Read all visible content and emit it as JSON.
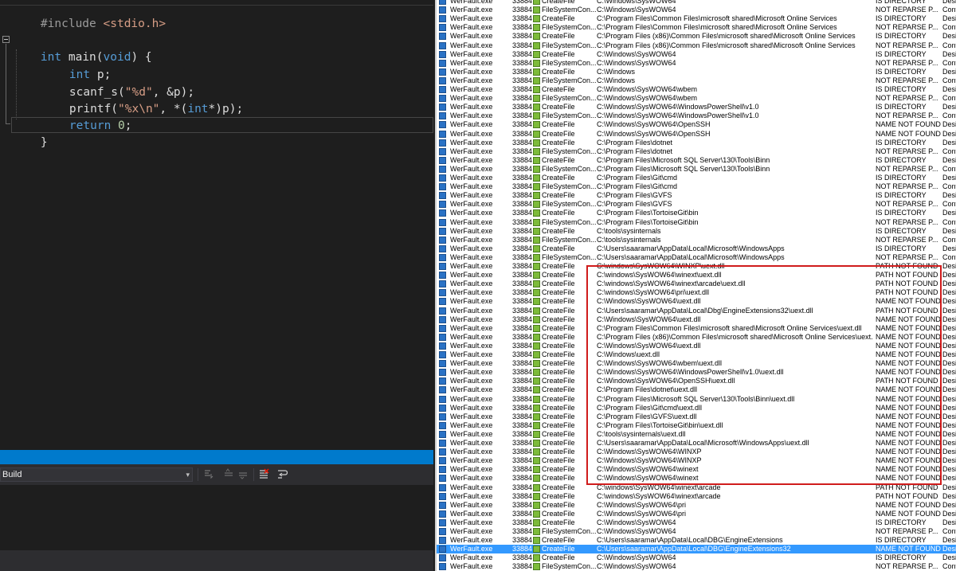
{
  "editor": {
    "include_directive": "#include",
    "include_file": "<stdio.h>",
    "line_main_type": "int",
    "line_main_name": " main(",
    "line_main_void": "void",
    "line_main_rest": ") {",
    "decl_type": "int",
    "decl_rest": " p;",
    "scanf_call": "scanf_s(",
    "scanf_fmt": "\"%d\"",
    "scanf_rest": ", &p);",
    "printf_call": "printf(",
    "printf_fmt": "\"%x\\n\"",
    "printf_mid": ", *(",
    "printf_cast": "int",
    "printf_rest": "*)p);",
    "return_kw": "return",
    "return_val": "0",
    "return_semicolon": ";",
    "close_brace": "}"
  },
  "output_pane": {
    "source_selected": "Build",
    "dropdown_chevron": "▾"
  },
  "procmon": {
    "process": "WerFault.exe",
    "pid": "33884",
    "rows": [
      {
        "op": "CreateFile",
        "path": "C:\\Windows\\SysWOW64",
        "result": "IS DIRECTORY",
        "detail": "Desi"
      },
      {
        "op": "FileSystemCon...",
        "path": "C:\\Windows\\SysWOW64",
        "result": "NOT REPARSE P...",
        "detail": "Cont"
      },
      {
        "op": "CreateFile",
        "path": "C:\\Program Files\\Common Files\\microsoft shared\\Microsoft Online Services",
        "result": "IS DIRECTORY",
        "detail": "Desi"
      },
      {
        "op": "FileSystemCon...",
        "path": "C:\\Program Files\\Common Files\\microsoft shared\\Microsoft Online Services",
        "result": "NOT REPARSE P...",
        "detail": "Cont"
      },
      {
        "op": "CreateFile",
        "path": "C:\\Program Files (x86)\\Common Files\\microsoft shared\\Microsoft Online Services",
        "result": "IS DIRECTORY",
        "detail": "Desi"
      },
      {
        "op": "FileSystemCon...",
        "path": "C:\\Program Files (x86)\\Common Files\\microsoft shared\\Microsoft Online Services",
        "result": "NOT REPARSE P...",
        "detail": "Cont"
      },
      {
        "op": "CreateFile",
        "path": "C:\\Windows\\SysWOW64",
        "result": "IS DIRECTORY",
        "detail": "Desi"
      },
      {
        "op": "FileSystemCon...",
        "path": "C:\\Windows\\SysWOW64",
        "result": "NOT REPARSE P...",
        "detail": "Cont"
      },
      {
        "op": "CreateFile",
        "path": "C:\\Windows",
        "result": "IS DIRECTORY",
        "detail": "Desi"
      },
      {
        "op": "FileSystemCon...",
        "path": "C:\\Windows",
        "result": "NOT REPARSE P...",
        "detail": "Cont"
      },
      {
        "op": "CreateFile",
        "path": "C:\\Windows\\SysWOW64\\wbem",
        "result": "IS DIRECTORY",
        "detail": "Desi"
      },
      {
        "op": "FileSystemCon...",
        "path": "C:\\Windows\\SysWOW64\\wbem",
        "result": "NOT REPARSE P...",
        "detail": "Cont"
      },
      {
        "op": "CreateFile",
        "path": "C:\\Windows\\SysWOW64\\WindowsPowerShell\\v1.0",
        "result": "IS DIRECTORY",
        "detail": "Desi"
      },
      {
        "op": "FileSystemCon...",
        "path": "C:\\Windows\\SysWOW64\\WindowsPowerShell\\v1.0",
        "result": "NOT REPARSE P...",
        "detail": "Cont"
      },
      {
        "op": "CreateFile",
        "path": "C:\\Windows\\SysWOW64\\OpenSSH",
        "result": "NAME NOT FOUND",
        "detail": "Desi"
      },
      {
        "op": "CreateFile",
        "path": "C:\\Windows\\SysWOW64\\OpenSSH",
        "result": "NAME NOT FOUND",
        "detail": "Desi"
      },
      {
        "op": "CreateFile",
        "path": "C:\\Program Files\\dotnet",
        "result": "IS DIRECTORY",
        "detail": "Desi"
      },
      {
        "op": "FileSystemCon...",
        "path": "C:\\Program Files\\dotnet",
        "result": "NOT REPARSE P...",
        "detail": "Cont"
      },
      {
        "op": "CreateFile",
        "path": "C:\\Program Files\\Microsoft SQL Server\\130\\Tools\\Binn",
        "result": "IS DIRECTORY",
        "detail": "Desi"
      },
      {
        "op": "FileSystemCon...",
        "path": "C:\\Program Files\\Microsoft SQL Server\\130\\Tools\\Binn",
        "result": "NOT REPARSE P...",
        "detail": "Cont"
      },
      {
        "op": "CreateFile",
        "path": "C:\\Program Files\\Git\\cmd",
        "result": "IS DIRECTORY",
        "detail": "Desi"
      },
      {
        "op": "FileSystemCon...",
        "path": "C:\\Program Files\\Git\\cmd",
        "result": "NOT REPARSE P...",
        "detail": "Cont"
      },
      {
        "op": "CreateFile",
        "path": "C:\\Program Files\\GVFS",
        "result": "IS DIRECTORY",
        "detail": "Desi"
      },
      {
        "op": "FileSystemCon...",
        "path": "C:\\Program Files\\GVFS",
        "result": "NOT REPARSE P...",
        "detail": "Cont"
      },
      {
        "op": "CreateFile",
        "path": "C:\\Program Files\\TortoiseGit\\bin",
        "result": "IS DIRECTORY",
        "detail": "Desi"
      },
      {
        "op": "FileSystemCon...",
        "path": "C:\\Program Files\\TortoiseGit\\bin",
        "result": "NOT REPARSE P...",
        "detail": "Cont"
      },
      {
        "op": "CreateFile",
        "path": "C:\\tools\\sysinternals",
        "result": "IS DIRECTORY",
        "detail": "Desi"
      },
      {
        "op": "FileSystemCon...",
        "path": "C:\\tools\\sysinternals",
        "result": "NOT REPARSE P...",
        "detail": "Cont"
      },
      {
        "op": "CreateFile",
        "path": "C:\\Users\\saaramar\\AppData\\Local\\Microsoft\\WindowsApps",
        "result": "IS DIRECTORY",
        "detail": "Desi"
      },
      {
        "op": "FileSystemCon...",
        "path": "C:\\Users\\saaramar\\AppData\\Local\\Microsoft\\WindowsApps",
        "result": "NOT REPARSE P...",
        "detail": "Cont"
      },
      {
        "op": "CreateFile",
        "path": "C:\\windows\\SysWOW64\\WINXP\\uext.dll",
        "result": "PATH NOT FOUND",
        "detail": "Desi"
      },
      {
        "op": "CreateFile",
        "path": "C:\\windows\\SysWOW64\\winext\\uext.dll",
        "result": "PATH NOT FOUND",
        "detail": "Desi"
      },
      {
        "op": "CreateFile",
        "path": "C:\\windows\\SysWOW64\\winext\\arcade\\uext.dll",
        "result": "PATH NOT FOUND",
        "detail": "Desi"
      },
      {
        "op": "CreateFile",
        "path": "C:\\windows\\SysWOW64\\pri\\uext.dll",
        "result": "PATH NOT FOUND",
        "detail": "Desi"
      },
      {
        "op": "CreateFile",
        "path": "C:\\Windows\\SysWOW64\\uext.dll",
        "result": "NAME NOT FOUND",
        "detail": "Desi"
      },
      {
        "op": "CreateFile",
        "path": "C:\\Users\\saaramar\\AppData\\Local\\Dbg\\EngineExtensions32\\uext.dll",
        "result": "PATH NOT FOUND",
        "detail": "Desi"
      },
      {
        "op": "CreateFile",
        "path": "C:\\Windows\\SysWOW64\\uext.dll",
        "result": "NAME NOT FOUND",
        "detail": "Desi"
      },
      {
        "op": "CreateFile",
        "path": "C:\\Program Files\\Common Files\\microsoft shared\\Microsoft Online Services\\uext.dll",
        "result": "NAME NOT FOUND",
        "detail": "Desi"
      },
      {
        "op": "CreateFile",
        "path": "C:\\Program Files (x86)\\Common Files\\microsoft shared\\Microsoft Online Services\\uext.",
        "result": "NAME NOT FOUND",
        "detail": "Desi"
      },
      {
        "op": "CreateFile",
        "path": "C:\\Windows\\SysWOW64\\uext.dll",
        "result": "NAME NOT FOUND",
        "detail": "Desi"
      },
      {
        "op": "CreateFile",
        "path": "C:\\Windows\\uext.dll",
        "result": "NAME NOT FOUND",
        "detail": "Desi"
      },
      {
        "op": "CreateFile",
        "path": "C:\\Windows\\SysWOW64\\wbem\\uext.dll",
        "result": "NAME NOT FOUND",
        "detail": "Desi"
      },
      {
        "op": "CreateFile",
        "path": "C:\\Windows\\SysWOW64\\WindowsPowerShell\\v1.0\\uext.dll",
        "result": "NAME NOT FOUND",
        "detail": "Desi"
      },
      {
        "op": "CreateFile",
        "path": "C:\\Windows\\SysWOW64\\OpenSSH\\uext.dll",
        "result": "PATH NOT FOUND",
        "detail": "Desi"
      },
      {
        "op": "CreateFile",
        "path": "C:\\Program Files\\dotnet\\uext.dll",
        "result": "NAME NOT FOUND",
        "detail": "Desi"
      },
      {
        "op": "CreateFile",
        "path": "C:\\Program Files\\Microsoft SQL Server\\130\\Tools\\Binn\\uext.dll",
        "result": "NAME NOT FOUND",
        "detail": "Desi"
      },
      {
        "op": "CreateFile",
        "path": "C:\\Program Files\\Git\\cmd\\uext.dll",
        "result": "NAME NOT FOUND",
        "detail": "Desi"
      },
      {
        "op": "CreateFile",
        "path": "C:\\Program Files\\GVFS\\uext.dll",
        "result": "NAME NOT FOUND",
        "detail": "Desi"
      },
      {
        "op": "CreateFile",
        "path": "C:\\Program Files\\TortoiseGit\\bin\\uext.dll",
        "result": "NAME NOT FOUND",
        "detail": "Desi"
      },
      {
        "op": "CreateFile",
        "path": "C:\\tools\\sysinternals\\uext.dll",
        "result": "NAME NOT FOUND",
        "detail": "Desi"
      },
      {
        "op": "CreateFile",
        "path": "C:\\Users\\saaramar\\AppData\\Local\\Microsoft\\WindowsApps\\uext.dll",
        "result": "NAME NOT FOUND",
        "detail": "Desi"
      },
      {
        "op": "CreateFile",
        "path": "C:\\Windows\\SysWOW64\\WINXP",
        "result": "NAME NOT FOUND",
        "detail": "Desi"
      },
      {
        "op": "CreateFile",
        "path": "C:\\Windows\\SysWOW64\\WINXP",
        "result": "NAME NOT FOUND",
        "detail": "Desi"
      },
      {
        "op": "CreateFile",
        "path": "C:\\Windows\\SysWOW64\\winext",
        "result": "NAME NOT FOUND",
        "detail": "Desi"
      },
      {
        "op": "CreateFile",
        "path": "C:\\Windows\\SysWOW64\\winext",
        "result": "NAME NOT FOUND",
        "detail": "Desi"
      },
      {
        "op": "CreateFile",
        "path": "C:\\windows\\SysWOW64\\winext\\arcade",
        "result": "PATH NOT FOUND",
        "detail": "Desi"
      },
      {
        "op": "CreateFile",
        "path": "C:\\windows\\SysWOW64\\winext\\arcade",
        "result": "PATH NOT FOUND",
        "detail": "Desi"
      },
      {
        "op": "CreateFile",
        "path": "C:\\Windows\\SysWOW64\\pri",
        "result": "NAME NOT FOUND",
        "detail": "Desi"
      },
      {
        "op": "CreateFile",
        "path": "C:\\Windows\\SysWOW64\\pri",
        "result": "NAME NOT FOUND",
        "detail": "Desi"
      },
      {
        "op": "CreateFile",
        "path": "C:\\Windows\\SysWOW64",
        "result": "IS DIRECTORY",
        "detail": "Desi"
      },
      {
        "op": "FileSystemCon...",
        "path": "C:\\Windows\\SysWOW64",
        "result": "NOT REPARSE P...",
        "detail": "Cont"
      },
      {
        "op": "CreateFile",
        "path": "C:\\Users\\saaramar\\AppData\\Local\\DBG\\EngineExtensions",
        "result": "IS DIRECTORY",
        "detail": "Desi"
      },
      {
        "op": "CreateFile",
        "path": "C:\\Users\\saaramar\\AppData\\Local\\DBG\\EngineExtensions32",
        "result": "NAME NOT FOUND",
        "detail": "Desi",
        "selected": true
      },
      {
        "op": "CreateFile",
        "path": "C:\\Windows\\SysWOW64",
        "result": "IS DIRECTORY",
        "detail": "Desi"
      },
      {
        "op": "FileSystemCon...",
        "path": "C:\\Windows\\SysWOW64",
        "result": "NOT REPARSE P...",
        "detail": "Cont"
      }
    ]
  }
}
